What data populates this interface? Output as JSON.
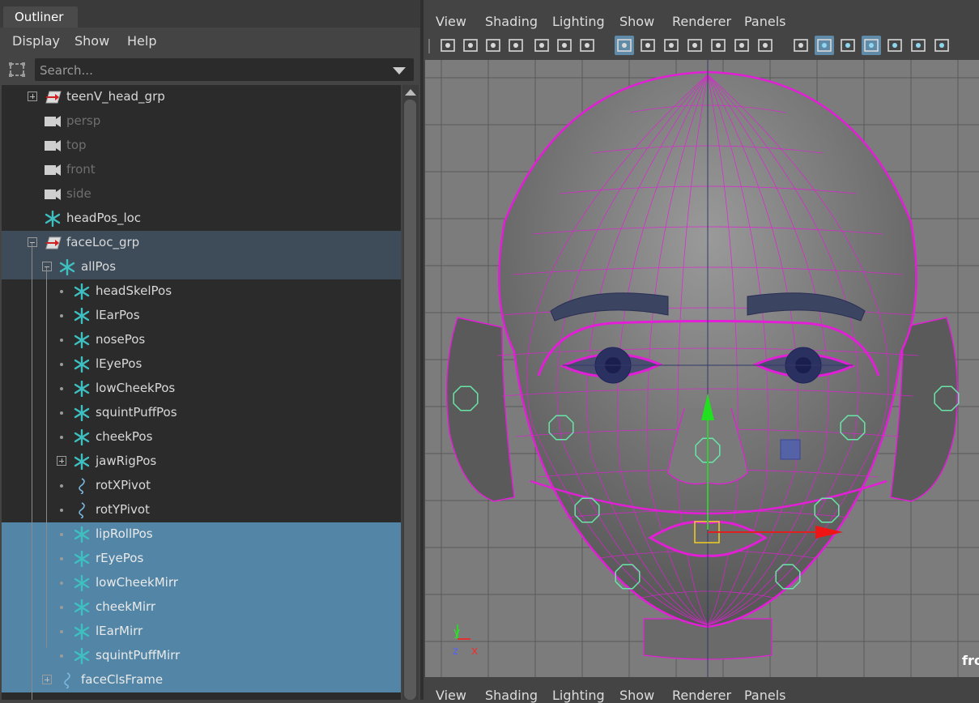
{
  "outliner": {
    "tab_label": "Outliner",
    "menu": [
      "Display",
      "Show",
      "Help"
    ],
    "search_placeholder": "Search...",
    "items": [
      {
        "label": "teenV_head_grp",
        "icon": "transform-group-icon",
        "state": "normal"
      },
      {
        "label": "persp",
        "icon": "camera-icon",
        "state": "dimmed"
      },
      {
        "label": "top",
        "icon": "camera-icon",
        "state": "dimmed"
      },
      {
        "label": "front",
        "icon": "camera-icon",
        "state": "dimmed"
      },
      {
        "label": "side",
        "icon": "camera-icon",
        "state": "dimmed"
      },
      {
        "label": "headPos_loc",
        "icon": "locator-icon",
        "state": "normal"
      },
      {
        "label": "faceLoc_grp",
        "icon": "transform-group-icon",
        "state": "highlighted"
      },
      {
        "label": "allPos",
        "icon": "locator-icon",
        "state": "highlighted"
      },
      {
        "label": "headSkelPos",
        "icon": "locator-icon",
        "state": "normal"
      },
      {
        "label": "lEarPos",
        "icon": "locator-icon",
        "state": "normal"
      },
      {
        "label": "nosePos",
        "icon": "locator-icon",
        "state": "normal"
      },
      {
        "label": "lEyePos",
        "icon": "locator-icon",
        "state": "normal"
      },
      {
        "label": "lowCheekPos",
        "icon": "locator-icon",
        "state": "normal"
      },
      {
        "label": "squintPuffPos",
        "icon": "locator-icon",
        "state": "normal"
      },
      {
        "label": "cheekPos",
        "icon": "locator-icon",
        "state": "normal"
      },
      {
        "label": "jawRigPos",
        "icon": "locator-icon",
        "state": "normal"
      },
      {
        "label": "rotXPivot",
        "icon": "curve-icon",
        "state": "normal"
      },
      {
        "label": "rotYPivot",
        "icon": "curve-icon",
        "state": "normal"
      },
      {
        "label": "lipRollPos",
        "icon": "locator-icon",
        "state": "selected"
      },
      {
        "label": "rEyePos",
        "icon": "locator-icon",
        "state": "selected"
      },
      {
        "label": "lowCheekMirr",
        "icon": "locator-icon",
        "state": "selected"
      },
      {
        "label": "cheekMirr",
        "icon": "locator-icon",
        "state": "selected"
      },
      {
        "label": "lEarMirr",
        "icon": "locator-icon",
        "state": "selected"
      },
      {
        "label": "squintPuffMirr",
        "icon": "locator-icon",
        "state": "selected"
      },
      {
        "label": "faceClsFrame",
        "icon": "curve-icon",
        "state": "selected"
      }
    ]
  },
  "viewport": {
    "menu": [
      "View",
      "Shading",
      "Lighting",
      "Show",
      "Renderer",
      "Panels"
    ],
    "bottom_menu": [
      "View",
      "Shading",
      "Lighting",
      "Show",
      "Renderer",
      "Panels"
    ],
    "camera_label": "front",
    "axis_labels": {
      "y": "y",
      "z": "z",
      "x": "x"
    },
    "toolbar_icons": [
      "select-camera-icon",
      "lock-camera-icon",
      "camera-attributes-icon",
      "bookmark-icon",
      "image-plane-icon",
      "2d-pan-zoom-icon",
      "grease-pencil-icon",
      "grid-icon",
      "film-gate-icon",
      "resolution-gate-icon",
      "gate-mask-icon",
      "field-chart-icon",
      "safe-action-icon",
      "safe-title-icon",
      "wireframe-icon",
      "smooth-shade-icon",
      "default-material-icon",
      "wireframe-on-shaded-icon",
      "xray-icon",
      "use-default-light-icon",
      "shadows-icon"
    ]
  },
  "colors": {
    "selected_row": "#5285a6",
    "highlighted_row": "#3e4c5a",
    "wireframe": "#e21fd6",
    "locator": "#3fc0c0",
    "control_circle": "#68e6a8"
  }
}
